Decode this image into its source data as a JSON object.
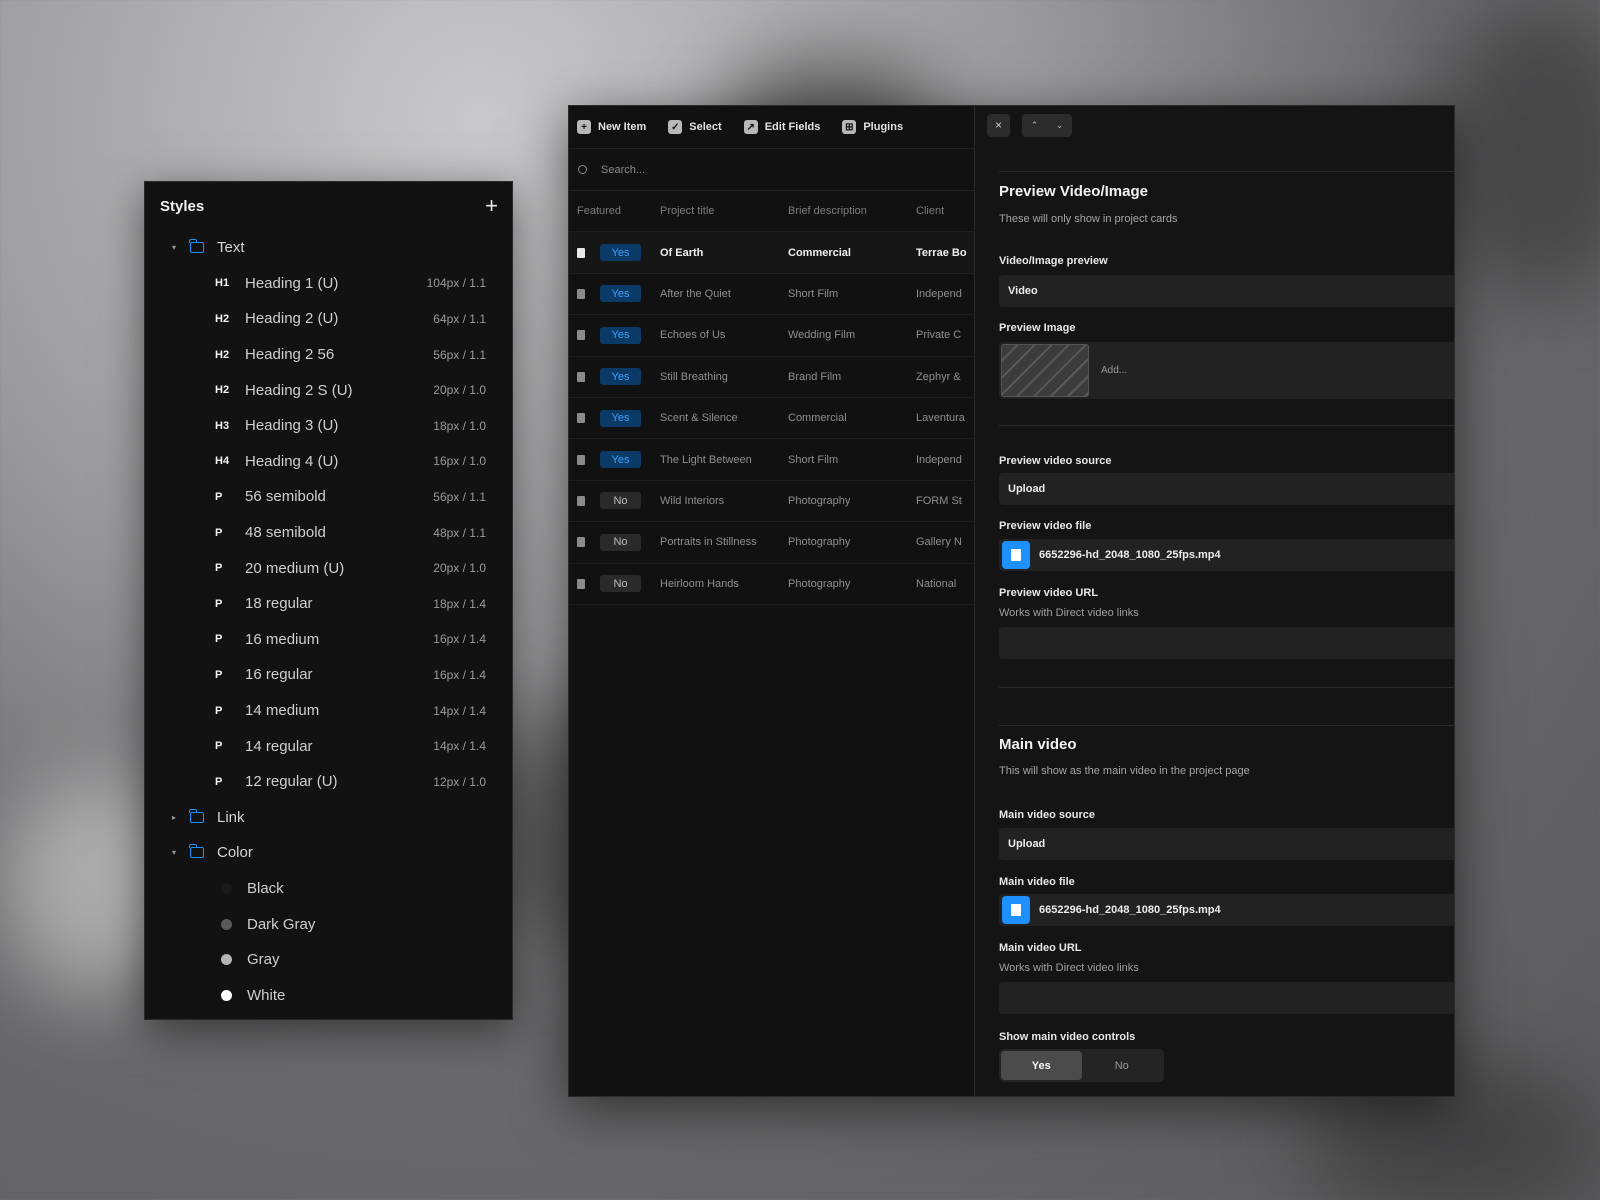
{
  "styles_panel": {
    "title": "Styles",
    "add_label": "+",
    "groups": [
      {
        "label": "Text",
        "expanded": true,
        "items": [
          {
            "tag": "H1",
            "name": "Heading 1 (U)",
            "meta": "104px / 1.1"
          },
          {
            "tag": "H2",
            "name": "Heading 2 (U)",
            "meta": "64px / 1.1"
          },
          {
            "tag": "H2",
            "name": "Heading 2 56",
            "meta": "56px / 1.1"
          },
          {
            "tag": "H2",
            "name": "Heading 2 S (U)",
            "meta": "20px / 1.0"
          },
          {
            "tag": "H3",
            "name": "Heading 3 (U)",
            "meta": "18px / 1.0"
          },
          {
            "tag": "H4",
            "name": "Heading 4 (U)",
            "meta": "16px / 1.0"
          },
          {
            "tag": "P",
            "name": "56 semibold",
            "meta": "56px / 1.1"
          },
          {
            "tag": "P",
            "name": "48 semibold",
            "meta": "48px / 1.1"
          },
          {
            "tag": "P",
            "name": "20 medium (U)",
            "meta": "20px / 1.0"
          },
          {
            "tag": "P",
            "name": "18 regular",
            "meta": "18px / 1.4"
          },
          {
            "tag": "P",
            "name": "16 medium",
            "meta": "16px / 1.4"
          },
          {
            "tag": "P",
            "name": "16 regular",
            "meta": "16px / 1.4"
          },
          {
            "tag": "P",
            "name": "14 medium",
            "meta": "14px / 1.4"
          },
          {
            "tag": "P",
            "name": "14 regular",
            "meta": "14px / 1.4"
          },
          {
            "tag": "P",
            "name": "12 regular (U)",
            "meta": "12px / 1.0"
          }
        ]
      },
      {
        "label": "Link",
        "expanded": false
      },
      {
        "label": "Color",
        "expanded": true,
        "colors": [
          {
            "name": "Black",
            "hex": "#1a1a1a"
          },
          {
            "name": "Dark Gray",
            "hex": "#5a5a5a"
          },
          {
            "name": "Gray",
            "hex": "#b5b5b5"
          },
          {
            "name": "White",
            "hex": "#ffffff"
          }
        ]
      }
    ]
  },
  "toolbar": {
    "new_item": "New Item",
    "select": "Select",
    "edit_fields": "Edit Fields",
    "plugins": "Plugins"
  },
  "search": {
    "placeholder": "Search..."
  },
  "table": {
    "columns": [
      "Featured",
      "Project title",
      "Brief description",
      "Client"
    ],
    "rows": [
      {
        "featured": "Yes",
        "title": "Of Earth",
        "desc": "Commercial",
        "client": "Terrae Bo",
        "active": true
      },
      {
        "featured": "Yes",
        "title": "After the Quiet",
        "desc": "Short Film",
        "client": "Independ"
      },
      {
        "featured": "Yes",
        "title": "Echoes of Us",
        "desc": "Wedding Film",
        "client": "Private C"
      },
      {
        "featured": "Yes",
        "title": "Still Breathing",
        "desc": "Brand Film",
        "client": "Zephyr &"
      },
      {
        "featured": "Yes",
        "title": "Scent & Silence",
        "desc": "Commercial",
        "client": "Laventura"
      },
      {
        "featured": "Yes",
        "title": "The Light Between",
        "desc": "Short Film",
        "client": "Independ"
      },
      {
        "featured": "No",
        "title": "Wild Interiors",
        "desc": "Photography",
        "client": "FORM St"
      },
      {
        "featured": "No",
        "title": "Portraits in Stillness",
        "desc": "Photography",
        "client": "Gallery N"
      },
      {
        "featured": "No",
        "title": "Heirloom Hands",
        "desc": "Photography",
        "client": "National"
      }
    ]
  },
  "detail": {
    "close": "×",
    "nav_up": "⌃",
    "nav_down": "⌄",
    "preview_section": {
      "title": "Preview Video/Image",
      "subtitle": "These will only show in project cards",
      "preview_type_label": "Video/Image preview",
      "preview_type_value": "Video",
      "image_label": "Preview Image",
      "image_add": "Add...",
      "source_label": "Preview video source",
      "source_value": "Upload",
      "file_label": "Preview video file",
      "file_value": "6652296-hd_2048_1080_25fps.mp4",
      "url_label": "Preview video URL",
      "url_help": "Works with Direct video links",
      "url_value": ""
    },
    "main_section": {
      "title": "Main video",
      "subtitle": "This will show as the main video in the project page",
      "source_label": "Main video source",
      "source_value": "Upload",
      "file_label": "Main video file",
      "file_value": "6652296-hd_2048_1080_25fps.mp4",
      "url_label": "Main video URL",
      "url_help": "Works with Direct video links",
      "url_value": "",
      "controls_label": "Show main video controls",
      "controls_yes": "Yes",
      "controls_no": "No",
      "controls_selected": "Yes"
    }
  },
  "colors": {
    "accent": "#1e90ff",
    "badge_yes_bg": "#0c3a66",
    "badge_yes_text": "#3aa0ff",
    "panel_bg": "#121212"
  }
}
